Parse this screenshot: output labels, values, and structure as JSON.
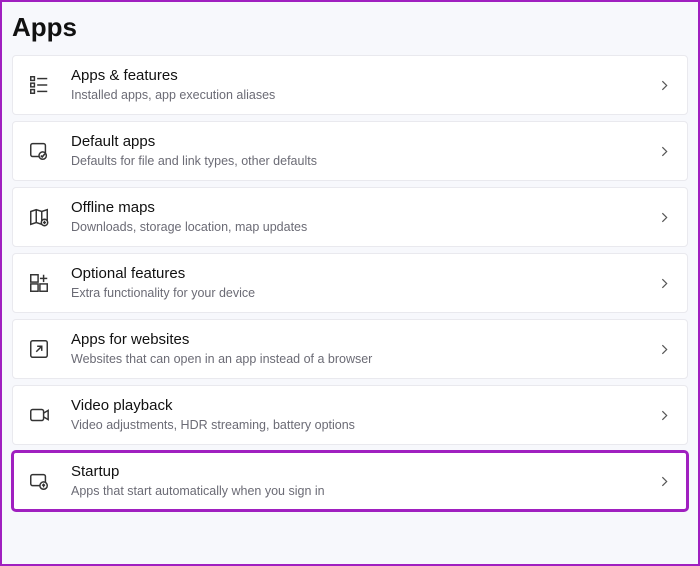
{
  "page": {
    "title": "Apps"
  },
  "items": [
    {
      "icon": "apps-features-icon",
      "title": "Apps & features",
      "subtitle": "Installed apps, app execution aliases",
      "highlighted": false
    },
    {
      "icon": "default-apps-icon",
      "title": "Default apps",
      "subtitle": "Defaults for file and link types, other defaults",
      "highlighted": false
    },
    {
      "icon": "offline-maps-icon",
      "title": "Offline maps",
      "subtitle": "Downloads, storage location, map updates",
      "highlighted": false
    },
    {
      "icon": "optional-features-icon",
      "title": "Optional features",
      "subtitle": "Extra functionality for your device",
      "highlighted": false
    },
    {
      "icon": "apps-websites-icon",
      "title": "Apps for websites",
      "subtitle": "Websites that can open in an app instead of a browser",
      "highlighted": false
    },
    {
      "icon": "video-playback-icon",
      "title": "Video playback",
      "subtitle": "Video adjustments, HDR streaming, battery options",
      "highlighted": false
    },
    {
      "icon": "startup-icon",
      "title": "Startup",
      "subtitle": "Apps that start automatically when you sign in",
      "highlighted": true
    }
  ]
}
